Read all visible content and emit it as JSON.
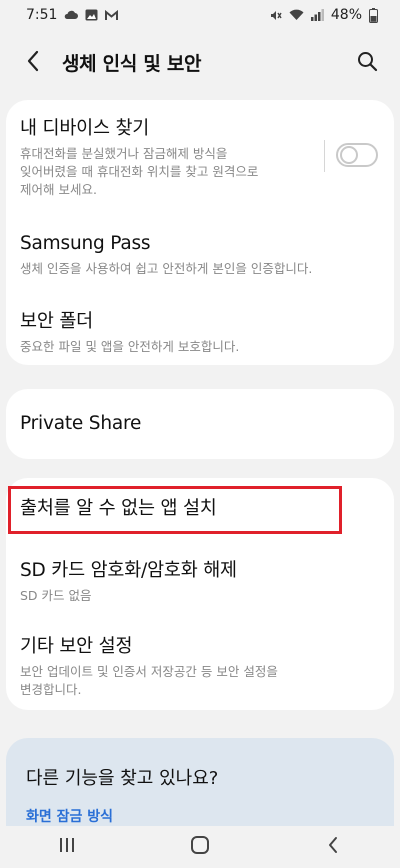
{
  "status_bar": {
    "time": "7:51",
    "battery": "48%",
    "left_icons": [
      "cloud-icon",
      "gallery-icon",
      "gmail-icon"
    ],
    "right_icons": [
      "mute-icon",
      "wifi-icon",
      "signal-icon",
      "battery-icon"
    ]
  },
  "header": {
    "title": "생체 인식 및 보안"
  },
  "settings": {
    "find_device": {
      "title": "내 디바이스 찾기",
      "subtitle_line1": "휴대전화를 분실했거나 잠금해제 방식을",
      "subtitle_line2": "잊어버렸을 때 휴대전화 위치를 찾고 원격으로",
      "subtitle_line3": "제어해 보세요.",
      "enabled": false
    },
    "samsung_pass": {
      "title": "Samsung Pass",
      "subtitle": "생체 인증을 사용하여 쉽고 안전하게 본인을 인증합니다."
    },
    "secure_folder": {
      "title": "보안 폴더",
      "subtitle": "중요한 파일 및 앱을 안전하게 보호합니다."
    },
    "private_share": {
      "title": "Private Share"
    },
    "unknown_apps": {
      "title": "출처를 알 수 없는 앱 설치"
    },
    "sd_encrypt": {
      "title": "SD 카드 암호화/암호화 해제",
      "subtitle": "SD 카드 없음"
    },
    "other_security": {
      "title": "기타 보안 설정",
      "subtitle_line1": "보안 업데이트 및 인증서 저장공간 등 보안 설정을",
      "subtitle_line2": "변경합니다."
    }
  },
  "suggestion": {
    "title": "다른 기능을 찾고 있나요?",
    "link": "화면 잠금 방식"
  },
  "colors": {
    "highlight": "#e0202a",
    "link": "#2a6fd6",
    "background": "#f2f2f2"
  }
}
